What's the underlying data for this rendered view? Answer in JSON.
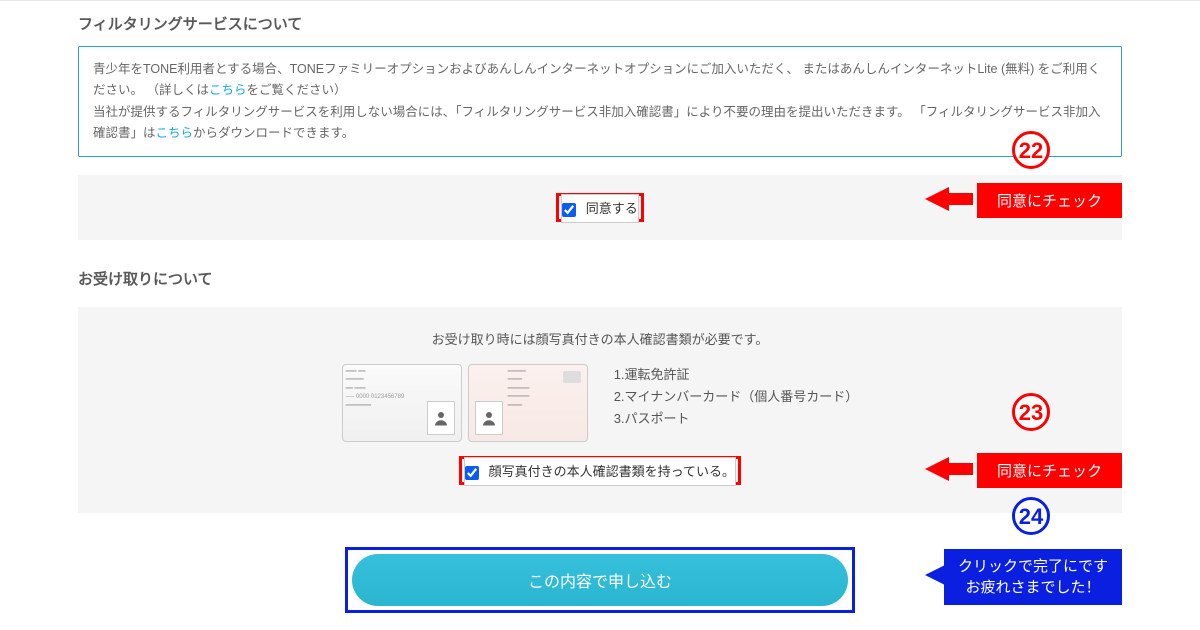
{
  "filtering": {
    "title": "フィルタリングサービスについて",
    "info_part1": "青少年をTONE利用者とする場合、TONEファミリーオプションおよびあんしんインターネットオプションにご加入いただく、 またはあんしんインターネットLite (無料) をご利用ください。 （詳しくは",
    "info_link1": "こちら",
    "info_part2": "をご覧ください）",
    "info_part3": "当社が提供するフィルタリングサービスを利用しない場合には、「フィルタリングサービス非加入確認書」により不要の理由を提出いただきます。 「フィルタリングサービス非加入確認書」は",
    "info_link2": "こちら",
    "info_part4": "からダウンロードできます。",
    "checkbox_label": "同意する"
  },
  "receipt": {
    "title": "お受け取りについて",
    "note": "お受け取り時には顔写真付きの本人確認書類が必要です。",
    "docs": {
      "d1": "1.運転免許証",
      "d2": "2.マイナンバーカード（個人番号カード）",
      "d3": "3.パスポート"
    },
    "checkbox_label": "顔写真付きの本人確認書類を持っている。"
  },
  "badges": {
    "b22": "22",
    "b23": "23",
    "b24": "24"
  },
  "labels": {
    "check_hint": "同意にチェック",
    "submit_hint_line1": "クリックで完了にです",
    "submit_hint_line2": "お疲れさまでした！"
  },
  "submit": {
    "button": "この内容で申し込む"
  }
}
